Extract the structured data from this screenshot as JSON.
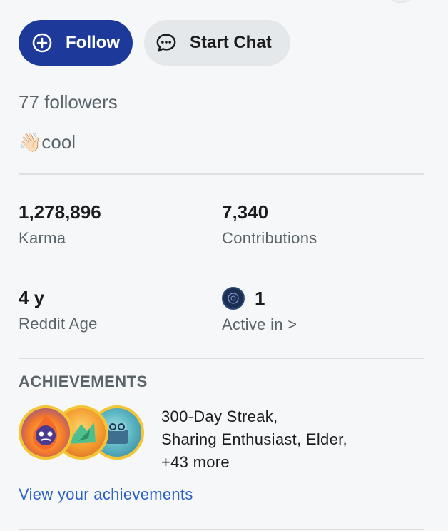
{
  "actions": {
    "follow_label": "Follow",
    "chat_label": "Start Chat"
  },
  "profile": {
    "followers": "77 followers",
    "bio_emoji": "👋🏻",
    "bio_text": "cool"
  },
  "stats": [
    {
      "value": "1,278,896",
      "label": "Karma"
    },
    {
      "value": "7,340",
      "label": "Contributions"
    },
    {
      "value": "4 y",
      "label": "Reddit Age"
    },
    {
      "value": "1",
      "label": "Active in >"
    }
  ],
  "achievements": {
    "title": "ACHIEVEMENTS",
    "line1": "300-Day Streak,",
    "line2": "Sharing Enthusiast, Elder,",
    "line3": "+43 more",
    "link": "View your achievements",
    "badge_icons": [
      "streak-badge-icon",
      "sharing-badge-icon",
      "elder-badge-icon"
    ]
  },
  "colors": {
    "follow_bg": "#1d3a9a",
    "chat_bg": "#e4e8ea",
    "link": "#2a62c6",
    "muted_text": "#5a6469"
  }
}
